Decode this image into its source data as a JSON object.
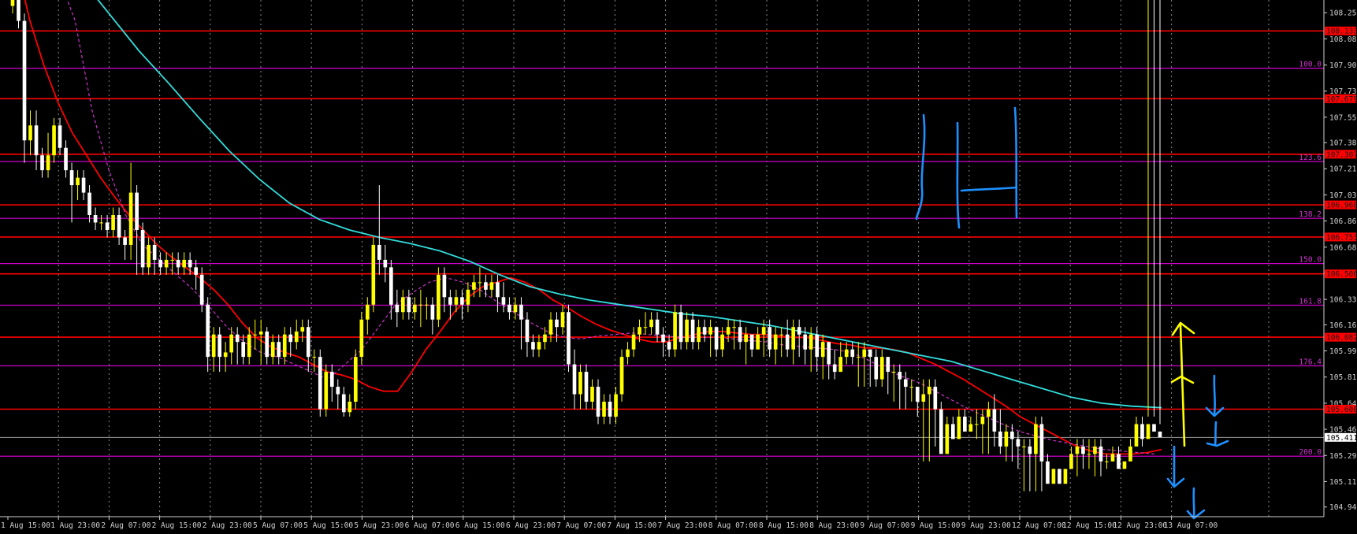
{
  "chart_data": {
    "type": "candlestick",
    "title": "",
    "xlabel": "",
    "ylabel": "",
    "ylim": [
      104.88,
      108.34
    ],
    "grid": true,
    "y_ticks": [
      "108.255",
      "108.080",
      "107.905",
      "107.730",
      "107.555",
      "107.385",
      "107.210",
      "107.035",
      "106.860",
      "106.685",
      "106.510",
      "106.335",
      "106.165",
      "105.990",
      "105.815",
      "105.640",
      "105.465",
      "105.290",
      "105.115",
      "104.945"
    ],
    "x_ticks": [
      "1 Aug 15:00",
      "1 Aug 23:00",
      "2 Aug 07:00",
      "2 Aug 15:00",
      "2 Aug 23:00",
      "5 Aug 07:00",
      "5 Aug 15:00",
      "5 Aug 23:00",
      "6 Aug 07:00",
      "6 Aug 15:00",
      "6 Aug 23:00",
      "7 Aug 07:00",
      "7 Aug 15:00",
      "7 Aug 23:00",
      "8 Aug 07:00",
      "8 Aug 15:00",
      "8 Aug 23:00",
      "9 Aug 07:00",
      "9 Aug 15:00",
      "9 Aug 23:00",
      "12 Aug 07:00",
      "12 Aug 15:00",
      "12 Aug 23:00",
      "13 Aug 07:00"
    ],
    "current_price": "105.411",
    "horizontal_levels": [
      {
        "value": 108.133,
        "label": "108.133",
        "color": "#ff0000",
        "kind": "price"
      },
      {
        "value": 107.679,
        "label": "107.679",
        "color": "#ff0000",
        "kind": "price"
      },
      {
        "value": 107.307,
        "label": "107.307",
        "color": "#ff0000",
        "kind": "price"
      },
      {
        "value": 106.968,
        "label": "106.968",
        "color": "#ff0000",
        "kind": "price"
      },
      {
        "value": 106.753,
        "label": "106.753",
        "color": "#ff0000",
        "kind": "price"
      },
      {
        "value": 106.506,
        "label": "106.506",
        "color": "#ff0000",
        "kind": "price"
      },
      {
        "value": 106.082,
        "label": "106.082",
        "color": "#ff0000",
        "kind": "price"
      },
      {
        "value": 105.6,
        "label": "105.600",
        "color": "#ff0000",
        "kind": "price"
      },
      {
        "value": 107.883,
        "label": "100.0",
        "color": "#cc00cc",
        "kind": "fib"
      },
      {
        "value": 107.258,
        "label": "123.6",
        "color": "#cc00cc",
        "kind": "fib"
      },
      {
        "value": 106.878,
        "label": "138.2",
        "color": "#cc00cc",
        "kind": "fib"
      },
      {
        "value": 106.575,
        "label": "150.0",
        "color": "#cc00cc",
        "kind": "fib"
      },
      {
        "value": 106.296,
        "label": "161.8",
        "color": "#cc00cc",
        "kind": "fib"
      },
      {
        "value": 105.89,
        "label": "176.4",
        "color": "#cc00cc",
        "kind": "fib"
      },
      {
        "value": 105.285,
        "label": "200.0",
        "color": "#cc00cc",
        "kind": "fib"
      }
    ],
    "candles": {
      "open": [
        108.3,
        108.4,
        108.2,
        107.4,
        107.5,
        107.3,
        107.2,
        107.3,
        107.5,
        107.35,
        107.2,
        107.1,
        107.15,
        107.05,
        106.9,
        106.85,
        106.85,
        106.8,
        106.9,
        106.75,
        106.7,
        107.05,
        106.8,
        106.55,
        106.7,
        106.6,
        106.55,
        106.6,
        106.6,
        106.55,
        106.6,
        106.55,
        106.5,
        106.3,
        105.95,
        106.1,
        105.95,
        105.98,
        106.1,
        106.05,
        105.95,
        106.1,
        106.1,
        106.12,
        105.95,
        106.05,
        105.95,
        106.1,
        106.05,
        106.12,
        106.15,
        105.95,
        105.95,
        105.6,
        105.85,
        105.75,
        105.7,
        105.58,
        105.65,
        105.95,
        106.2,
        106.3,
        106.7,
        106.6,
        106.55,
        106.3,
        106.25,
        106.35,
        106.25,
        106.3,
        106.3,
        106.3,
        106.2,
        106.5,
        106.35,
        106.3,
        106.35,
        106.3,
        106.4,
        106.45,
        106.45,
        106.4,
        106.45,
        106.35,
        106.3,
        106.25,
        106.3,
        106.2,
        106.05,
        106.0,
        106.05,
        106.1,
        106.2,
        106.15,
        106.25,
        105.9,
        105.7,
        105.85,
        105.65,
        105.75,
        105.55,
        105.65,
        105.55,
        105.7,
        105.95,
        106.0,
        106.1,
        106.15,
        106.15,
        106.2,
        106.1,
        106.05,
        106.0,
        106.25,
        106.05,
        106.2,
        106.05,
        106.15,
        106.1,
        106.15,
        106.0,
        106.1,
        106.15,
        106.15,
        106.05,
        106.1,
        106.0,
        106.1,
        106.15,
        106.0,
        106.1,
        106.1,
        106.0,
        106.15,
        106.1,
        106.0,
        106.1,
        105.95,
        106.05,
        105.9,
        105.85,
        105.95,
        106.0,
        105.95,
        105.95,
        106.0,
        105.95,
        105.8,
        105.95,
        105.85,
        105.85,
        105.8,
        105.75,
        105.75,
        105.65,
        105.7,
        105.75,
        105.6,
        105.3,
        105.5,
        105.4,
        105.55,
        105.45,
        105.5,
        105.5,
        105.55,
        105.6,
        105.45,
        105.35,
        105.45,
        105.4,
        105.35,
        105.35,
        105.3,
        105.5,
        105.25,
        105.1,
        105.2,
        105.1,
        105.2,
        105.3,
        105.35,
        105.3,
        105.3,
        105.35,
        105.25,
        105.25,
        105.3,
        105.2,
        105.25,
        105.35,
        105.5,
        105.4,
        105.5,
        105.45
      ],
      "close": [
        108.4,
        108.2,
        107.4,
        107.5,
        107.3,
        107.2,
        107.3,
        107.5,
        107.35,
        107.2,
        107.1,
        107.15,
        107.05,
        106.9,
        106.85,
        106.85,
        106.8,
        106.9,
        106.75,
        106.7,
        107.05,
        106.8,
        106.55,
        106.7,
        106.6,
        106.55,
        106.6,
        106.6,
        106.55,
        106.6,
        106.55,
        106.5,
        106.3,
        105.95,
        106.1,
        105.95,
        105.98,
        106.1,
        106.05,
        105.95,
        106.1,
        106.1,
        106.12,
        105.95,
        106.05,
        105.95,
        106.1,
        106.05,
        106.12,
        106.15,
        105.95,
        105.95,
        105.6,
        105.85,
        105.75,
        105.7,
        105.58,
        105.65,
        105.95,
        106.2,
        106.3,
        106.7,
        106.6,
        106.55,
        106.3,
        106.25,
        106.35,
        106.25,
        106.3,
        106.3,
        106.3,
        106.2,
        106.5,
        106.35,
        106.3,
        106.35,
        106.3,
        106.4,
        106.45,
        106.45,
        106.4,
        106.45,
        106.35,
        106.3,
        106.25,
        106.3,
        106.2,
        106.05,
        106.0,
        106.05,
        106.1,
        106.2,
        106.15,
        106.25,
        105.9,
        105.7,
        105.85,
        105.65,
        105.75,
        105.55,
        105.65,
        105.55,
        105.7,
        105.95,
        106.0,
        106.1,
        106.15,
        106.15,
        106.2,
        106.1,
        106.05,
        106.0,
        106.25,
        106.05,
        106.2,
        106.05,
        106.15,
        106.1,
        106.15,
        106.0,
        106.1,
        106.15,
        106.15,
        106.05,
        106.1,
        106.0,
        106.1,
        106.15,
        106.0,
        106.1,
        106.1,
        106.0,
        106.15,
        106.1,
        106.0,
        106.1,
        105.95,
        106.05,
        105.9,
        105.85,
        105.95,
        106.0,
        105.95,
        105.95,
        106.0,
        105.95,
        105.8,
        105.95,
        105.85,
        105.85,
        105.8,
        105.75,
        105.75,
        105.65,
        105.7,
        105.75,
        105.6,
        105.3,
        105.5,
        105.4,
        105.55,
        105.45,
        105.5,
        105.5,
        105.55,
        105.6,
        105.45,
        105.35,
        105.45,
        105.4,
        105.35,
        105.35,
        105.3,
        105.5,
        105.25,
        105.1,
        105.2,
        105.1,
        105.2,
        105.3,
        105.35,
        105.3,
        105.3,
        105.35,
        105.25,
        105.25,
        105.3,
        105.2,
        105.25,
        105.35,
        105.5,
        105.4,
        105.5,
        105.45,
        105.411
      ],
      "high": [
        108.45,
        108.45,
        108.25,
        107.6,
        107.6,
        107.35,
        107.45,
        107.55,
        107.55,
        107.4,
        107.25,
        107.2,
        107.2,
        107.1,
        106.95,
        106.9,
        106.9,
        106.95,
        106.95,
        106.8,
        107.25,
        107.1,
        106.85,
        106.75,
        106.75,
        106.65,
        106.65,
        106.65,
        106.65,
        106.65,
        106.65,
        106.6,
        106.55,
        106.35,
        106.15,
        106.15,
        106.05,
        106.15,
        106.15,
        106.1,
        106.15,
        106.2,
        106.2,
        106.15,
        106.1,
        106.1,
        106.15,
        106.15,
        106.2,
        106.2,
        106.2,
        106.0,
        106.0,
        105.9,
        105.9,
        105.8,
        105.75,
        105.7,
        106.0,
        106.25,
        106.35,
        106.75,
        107.1,
        106.7,
        106.6,
        106.4,
        106.4,
        106.4,
        106.35,
        106.4,
        106.35,
        106.35,
        106.55,
        106.55,
        106.4,
        106.4,
        106.4,
        106.45,
        106.5,
        106.55,
        106.5,
        106.5,
        106.5,
        106.45,
        106.35,
        106.35,
        106.35,
        106.25,
        106.1,
        106.1,
        106.15,
        106.25,
        106.25,
        106.3,
        106.3,
        106.0,
        105.9,
        105.9,
        105.8,
        105.8,
        105.7,
        105.7,
        105.75,
        106.0,
        106.05,
        106.15,
        106.2,
        106.25,
        106.25,
        106.25,
        106.15,
        106.1,
        106.3,
        106.3,
        106.25,
        106.25,
        106.2,
        106.2,
        106.2,
        106.15,
        106.15,
        106.2,
        106.2,
        106.2,
        106.15,
        106.1,
        106.15,
        106.2,
        106.2,
        106.15,
        106.15,
        106.2,
        106.2,
        106.2,
        106.15,
        106.15,
        106.15,
        106.1,
        106.0,
        106.0,
        106.05,
        106.05,
        106.05,
        106.05,
        106.05,
        106.0,
        106.0,
        106.0,
        105.95,
        105.9,
        105.9,
        105.85,
        105.8,
        105.75,
        105.8,
        105.8,
        105.8,
        105.65,
        105.55,
        105.55,
        105.6,
        105.6,
        105.55,
        105.6,
        105.6,
        105.65,
        105.7,
        105.6,
        105.5,
        105.5,
        105.45,
        105.4,
        105.4,
        105.55,
        105.55,
        105.3,
        105.25,
        105.25,
        105.25,
        105.35,
        105.4,
        105.4,
        105.4,
        105.4,
        105.4,
        105.3,
        105.35,
        105.35,
        105.3,
        105.4,
        105.55,
        105.55,
        105.55,
        105.55,
        105.5
      ],
      "low": [
        108.25,
        108.15,
        107.25,
        107.3,
        107.2,
        107.15,
        107.15,
        107.25,
        107.3,
        107.15,
        106.85,
        107.0,
        107.0,
        106.85,
        106.8,
        106.8,
        106.75,
        106.75,
        106.7,
        106.6,
        106.6,
        106.5,
        106.5,
        106.5,
        106.5,
        106.5,
        106.5,
        106.5,
        106.5,
        106.5,
        106.5,
        106.4,
        106.25,
        105.85,
        105.85,
        105.85,
        105.85,
        105.9,
        105.9,
        105.9,
        105.9,
        106.0,
        105.9,
        105.9,
        105.9,
        105.9,
        105.9,
        105.95,
        106.0,
        106.05,
        105.85,
        105.85,
        105.55,
        105.55,
        105.65,
        105.6,
        105.55,
        105.55,
        105.6,
        105.9,
        106.1,
        106.25,
        106.5,
        106.45,
        106.2,
        106.15,
        106.2,
        106.2,
        106.2,
        106.15,
        106.2,
        106.1,
        106.15,
        106.25,
        106.2,
        106.25,
        106.2,
        106.25,
        106.35,
        106.35,
        106.35,
        106.35,
        106.25,
        106.25,
        106.2,
        106.2,
        106.0,
        105.95,
        105.95,
        105.95,
        106.0,
        106.05,
        106.05,
        106.1,
        105.85,
        105.6,
        105.6,
        105.6,
        105.6,
        105.5,
        105.5,
        105.5,
        105.5,
        105.65,
        105.9,
        105.95,
        106.05,
        106.1,
        106.1,
        106.05,
        105.95,
        105.95,
        105.95,
        106.0,
        106.0,
        106.0,
        106.0,
        106.05,
        105.95,
        105.95,
        105.95,
        106.05,
        106.0,
        106.0,
        105.9,
        105.95,
        106.0,
        105.95,
        105.95,
        105.9,
        105.95,
        105.95,
        105.9,
        105.95,
        105.9,
        105.85,
        105.85,
        105.8,
        105.8,
        105.8,
        105.9,
        105.9,
        105.9,
        105.75,
        105.75,
        105.75,
        105.75,
        105.75,
        105.7,
        105.65,
        105.6,
        105.6,
        105.65,
        105.55,
        105.25,
        105.25,
        105.35,
        105.35,
        105.4,
        105.4,
        105.45,
        105.45,
        105.45,
        105.4,
        105.3,
        105.3,
        105.35,
        105.3,
        105.25,
        105.25,
        105.2,
        105.05,
        105.05,
        105.05,
        105.05,
        105.15,
        105.25,
        105.25,
        105.25,
        105.25,
        105.15,
        105.2,
        105.2,
        105.15,
        105.15,
        105.2,
        105.25,
        105.3,
        105.3,
        105.35,
        105.4,
        105.35
      ]
    },
    "series": [
      {
        "kind": "ma_fast",
        "color": "#ff0000",
        "style": "solid",
        "values": [
          108.6,
          108.2,
          107.9,
          107.65,
          107.45,
          107.3,
          107.15,
          107.02,
          106.9,
          106.8,
          106.7,
          106.62,
          106.55,
          106.48,
          106.4,
          106.3,
          106.18,
          106.08,
          106.02,
          105.98,
          105.95,
          105.9,
          105.85,
          105.83,
          105.8,
          105.75,
          105.72,
          105.72,
          105.85,
          106.0,
          106.12,
          106.25,
          106.35,
          106.42,
          106.45,
          106.48,
          106.45,
          106.4,
          106.33,
          106.28,
          106.22,
          106.17,
          106.13,
          106.1,
          106.07,
          106.05,
          106.05,
          106.08,
          106.1,
          106.12,
          106.12,
          106.11,
          106.1,
          106.1,
          106.09,
          106.08,
          106.08,
          106.06,
          106.04,
          106.03,
          106.01,
          106.01,
          106.0,
          105.98,
          105.94,
          105.9,
          105.85,
          105.8,
          105.74,
          105.68,
          105.62,
          105.55,
          105.5,
          105.45,
          105.4,
          105.35,
          105.32,
          105.3,
          105.3,
          105.3,
          105.31,
          105.33
        ]
      },
      {
        "kind": "ma_dashed",
        "color": "#cc33cc",
        "style": "dashed",
        "values": [
          108.5,
          108.2,
          107.6,
          107.2,
          106.9,
          106.7,
          106.6,
          106.5,
          106.4,
          106.28,
          106.15,
          106.05,
          105.98,
          105.95,
          105.9,
          105.85,
          105.8,
          105.9,
          106.0,
          106.15,
          106.3,
          106.38,
          106.45,
          106.48,
          106.45,
          106.4,
          106.32,
          106.25,
          106.18,
          106.12,
          106.08,
          106.07,
          106.09,
          106.1,
          106.11,
          106.1,
          106.09,
          106.08,
          106.08,
          106.08,
          106.07,
          106.06,
          106.05,
          106.03,
          106.02,
          106.01,
          106.0,
          105.98,
          105.93,
          105.87,
          105.82,
          105.78,
          105.72,
          105.66,
          105.6,
          105.55,
          105.5,
          105.45,
          105.42,
          105.39,
          105.37,
          105.35,
          105.33,
          105.32,
          105.31,
          105.3
        ]
      },
      {
        "kind": "ma_slow",
        "color": "#33dddd",
        "style": "solid",
        "values": [
          108.5,
          108.25,
          108.0,
          107.78,
          107.55,
          107.33,
          107.14,
          106.98,
          106.87,
          106.8,
          106.75,
          106.71,
          106.66,
          106.59,
          106.5,
          106.42,
          106.37,
          106.33,
          106.3,
          106.27,
          106.24,
          106.22,
          106.19,
          106.16,
          106.12,
          106.08,
          106.04,
          106.0,
          105.96,
          105.92,
          105.86,
          105.8,
          105.74,
          105.68,
          105.64,
          105.62,
          105.61
        ]
      }
    ]
  },
  "annotations": [
    {
      "type": "handwritten",
      "text": "1H",
      "color": "#1e90ff"
    },
    {
      "type": "arrow",
      "direction": "up",
      "color": "#ffff00",
      "count": 2
    },
    {
      "type": "arrow",
      "direction": "down",
      "color": "#1e90ff",
      "count": 4
    }
  ]
}
